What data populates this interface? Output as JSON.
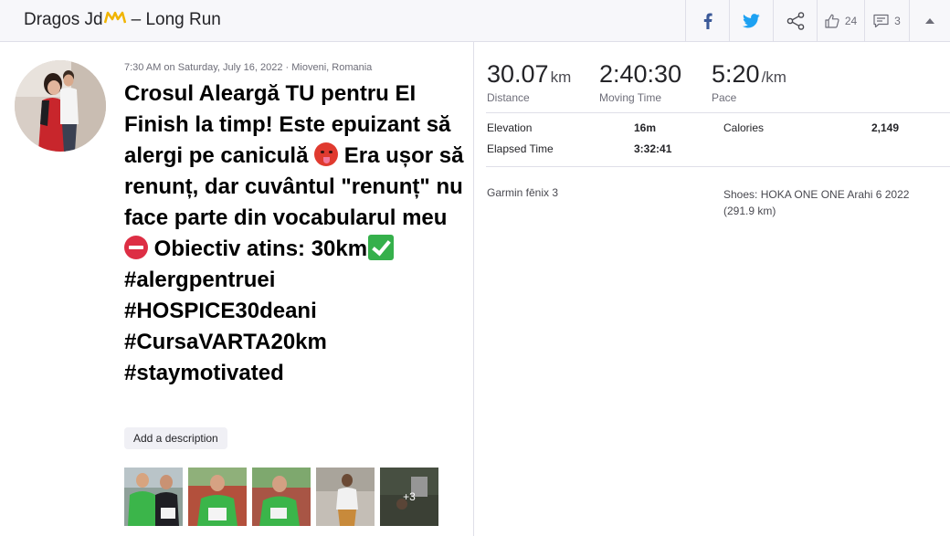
{
  "header": {
    "athlete": "Dragos Jd",
    "separator": "–",
    "activity_type": "Long Run",
    "kudos_count": "24",
    "comments_count": "3"
  },
  "activity": {
    "meta": "7:30 AM on Saturday, July 16, 2022 · Mioveni, Romania",
    "title_parts": [
      "Crosul Aleargă TU pentru EI Finish la timp! Este epuizant să alergi pe caniculă ",
      " Era ușor să renunț, dar cuvântul \"renunț\" nu face parte din vocabularul meu ",
      " Obiectiv atins: 30km",
      " #alergpentruei #HOSPICE30deani #CursaVARTA20km #staymotivated"
    ],
    "add_description_label": "Add a description",
    "photos_more_label": "+3"
  },
  "stats": {
    "distance": {
      "value": "30.07",
      "unit": "km",
      "label": "Distance"
    },
    "moving_time": {
      "value": "2:40:30",
      "label": "Moving Time"
    },
    "pace": {
      "value": "5:20",
      "unit": "/km",
      "label": "Pace"
    }
  },
  "more_stats": {
    "elevation_label": "Elevation",
    "elevation_value": "16m",
    "calories_label": "Calories",
    "calories_value": "2,149",
    "elapsed_label": "Elapsed Time",
    "elapsed_value": "3:32:41"
  },
  "gear": {
    "device": "Garmin fēnix 3",
    "shoes": "Shoes: HOKA ONE ONE Arahi 6 2022 (291.9 km)"
  },
  "colors": {
    "facebook": "#3b5998",
    "twitter": "#1da1f2",
    "brand_orange": "#fc4c02",
    "crown_gold": "#f0b400"
  }
}
